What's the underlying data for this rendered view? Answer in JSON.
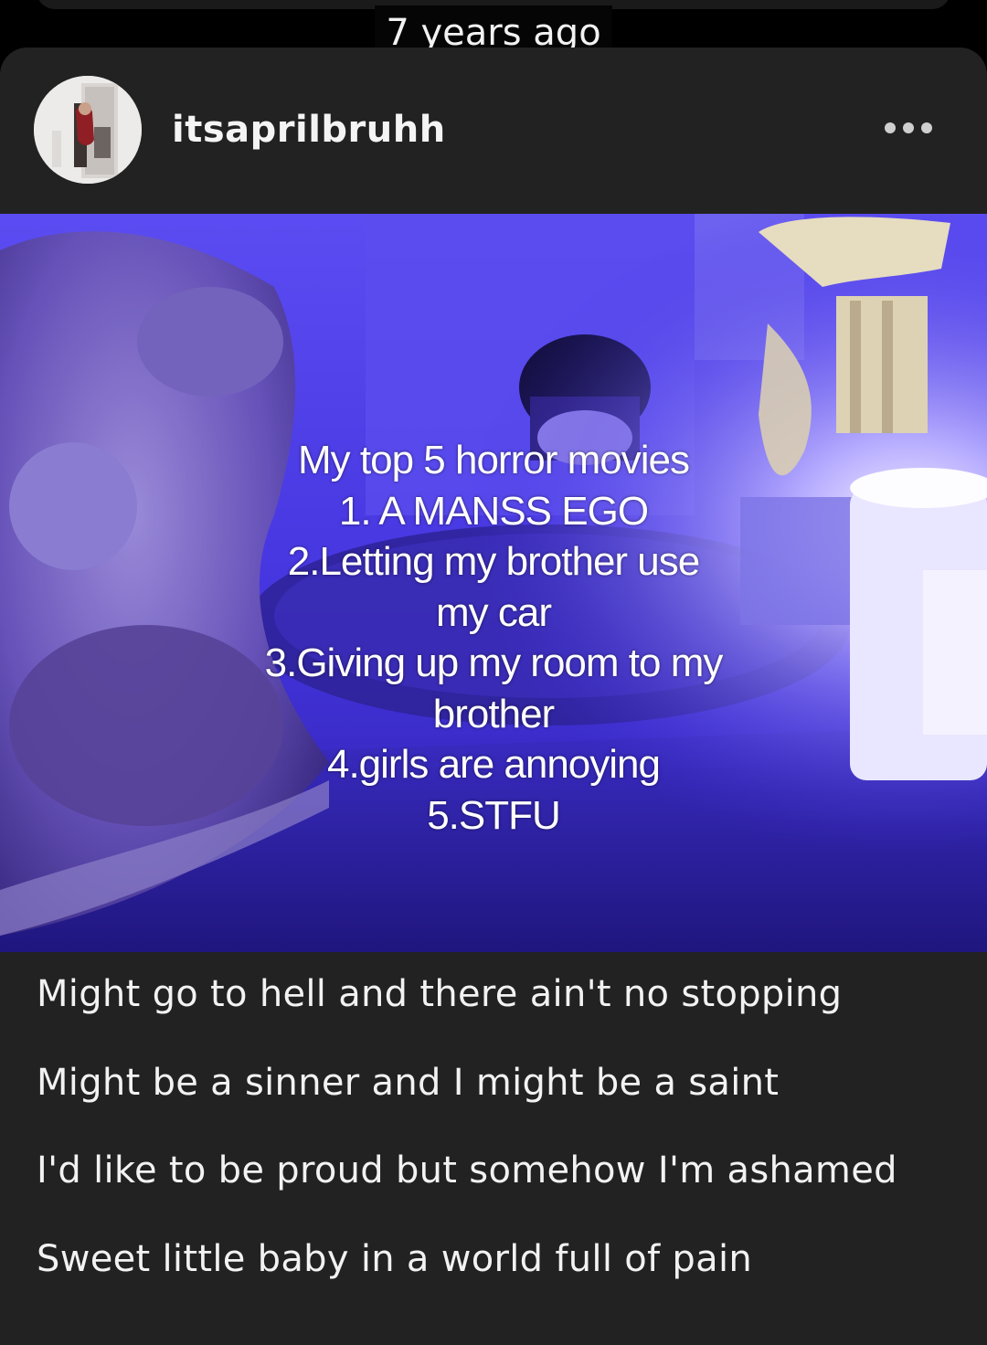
{
  "feed": {
    "timestamp": "7 years ago"
  },
  "post": {
    "username": "itsaprilbruhh",
    "avatar_icon": "profile-photo",
    "more_icon": "more-horizontal-icon",
    "image": {
      "overlay_lines": [
        "My top 5 horror movies",
        "1. A MANSS EGO",
        "2.Letting my brother use",
        "my car",
        "3.Giving up my room to my",
        "brother",
        "4.girls are annoying",
        "5.STFU"
      ]
    },
    "caption_lines": [
      "Might go to hell and there ain't no stopping",
      "Might be a sinner and I might be a saint",
      "I'd like to be proud but somehow I'm ashamed",
      "Sweet little baby in a world full of pain"
    ]
  },
  "colors": {
    "background": "#000000",
    "card": "#222222",
    "image_tint": "#3a2ad6",
    "text": "#f2f2f2"
  }
}
